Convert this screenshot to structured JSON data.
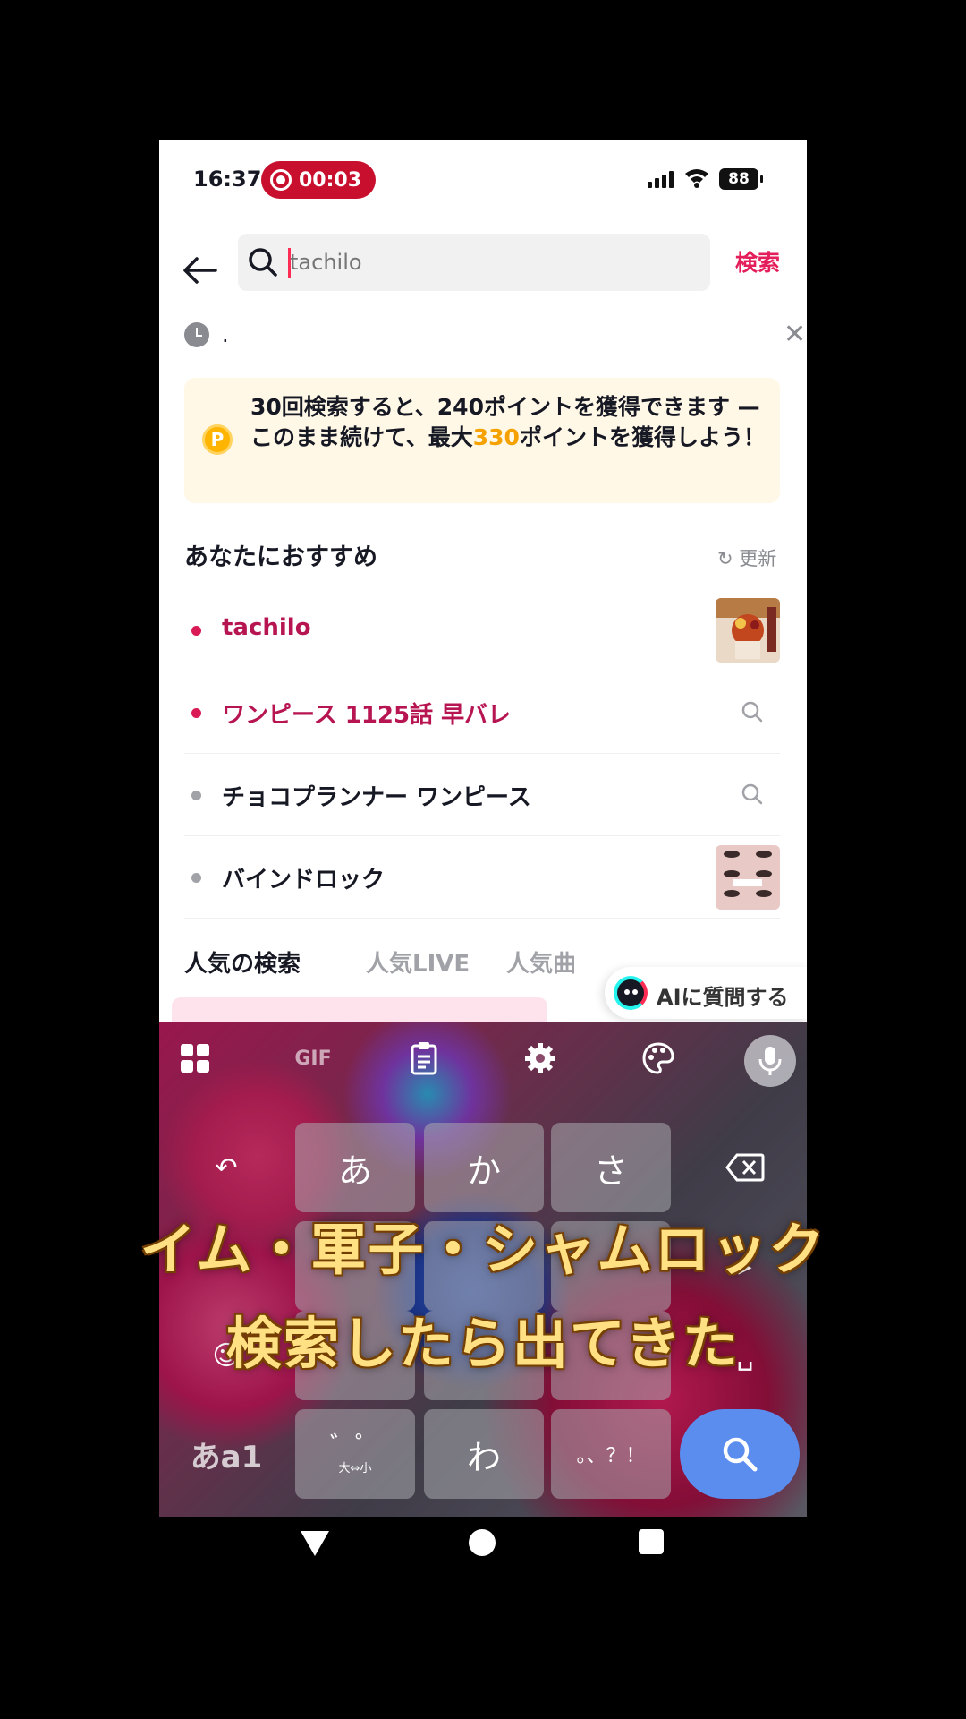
{
  "status_bar": {
    "time": "16:37",
    "recording": "00:03",
    "battery": "88"
  },
  "search": {
    "placeholder": "tachilo",
    "button_label": "検索"
  },
  "history": {
    "item": "."
  },
  "promo": {
    "line_before": "30回検索すると、240ポイントを獲得できます — このまま続けて、最大",
    "highlight": "330",
    "line_after": "ポイントを獲得しよう！"
  },
  "recommend": {
    "title": "あなたにおすすめ",
    "refresh": "更新",
    "items": [
      {
        "label": "tachilo"
      },
      {
        "label": "ワンピース 1125話 早バレ"
      },
      {
        "label": "チョコプランナー ワンピース"
      },
      {
        "label": "バインドロック"
      }
    ]
  },
  "tabs": [
    "人気の検索",
    "人気LIVE",
    "人気曲"
  ],
  "ai_button": "AIに質問する",
  "keyboard": {
    "keys": [
      "あ",
      "か",
      "さ",
      "わ"
    ],
    "mode": "あa1",
    "dakuten_label": "大⇔小",
    "punct": "。、？！",
    "toolbar_gif": "GIF"
  },
  "caption": {
    "line1": "イム・軍子・シャムロック",
    "line2": "検索したら出てきた"
  },
  "colors": {
    "accent": "#e41e5a",
    "highlight": "#f5a200",
    "enter": "#5b8def"
  }
}
